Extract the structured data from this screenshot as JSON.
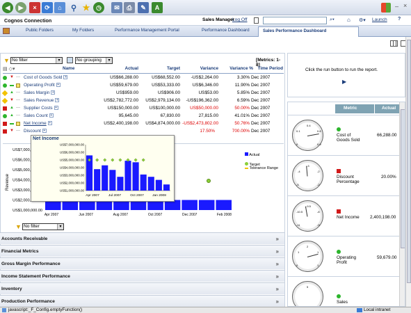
{
  "browser": {
    "back_label": "◀",
    "forward_label": "▶",
    "dropdown_arrow": "▾",
    "win_min": "–",
    "win_close": "×"
  },
  "portal": {
    "title": "Cognos Connection",
    "user": "Sales Manager",
    "logoff": "Log Off",
    "launch": "Launch",
    "home_glyph": "⌂",
    "help_glyph": "?"
  },
  "tabs": [
    {
      "label": "Public Folders"
    },
    {
      "label": "My Folders"
    },
    {
      "label": "Performance Management Portal"
    },
    {
      "label": "Performance Dashboard"
    },
    {
      "label": "Sales Performance Dashboard"
    }
  ],
  "filters": {
    "filter": "No filter",
    "grouping": "No grouping",
    "metrics_count": "[Metrics: 1-8]",
    "filter2": "No filter"
  },
  "table": {
    "headers": {
      "name": "Name",
      "actual": "Actual",
      "target": "Target",
      "variance": "Variance",
      "variance_pct": "Variance %",
      "time": "Time Period"
    },
    "rows": [
      {
        "name": "Cost of Goods Sold",
        "actual": "US$66,288.00",
        "target": "US$68,552.00",
        "variance": "-US$2,264.00",
        "variance_pct": "3.30%",
        "time": "Dec 2007"
      },
      {
        "name": "Operating Profit",
        "actual": "US$59,679.00",
        "target": "US$53,333.00",
        "variance": "US$6,346.00",
        "variance_pct": "11.90%",
        "time": "Dec 2007"
      },
      {
        "name": "Sales Margin",
        "actual": "US$959.00",
        "target": "US$906.00",
        "variance": "US$53.00",
        "variance_pct": "5.85%",
        "time": "Dec 2007"
      },
      {
        "name": "Sales Revenue",
        "actual": "US$2,782,772.00",
        "target": "US$2,979,134.00",
        "variance": "-US$196,362.00",
        "variance_pct": "6.59%",
        "time": "Dec 2007"
      },
      {
        "name": "Supplier Costs",
        "actual": "US$150,000.00",
        "target": "US$100,000.00",
        "variance": "US$50,000.00",
        "variance_pct": "50.00%",
        "time": "Dec 2007"
      },
      {
        "name": "Sales Count",
        "actual": "95,645.00",
        "target": "67,830.00",
        "variance": "27,815.00",
        "variance_pct": "41.01%",
        "time": "Dec 2007"
      },
      {
        "name": "Net Income",
        "actual": "US$2,400,198.00",
        "target": "US$4,874,000.00",
        "variance": "-US$2,473,802.00",
        "variance_pct": "50.76%",
        "time": "Dec 2007"
      },
      {
        "name": "Discount",
        "actual": "",
        "target": "",
        "variance": "",
        "variance_pct": "17.50%",
        "time": "Dec 2007",
        "extra": "700.00%"
      }
    ]
  },
  "status_colors": {
    "green": "#2db52d",
    "red": "#d11a1a",
    "yellow": "#f2c200",
    "accent": "#1b3d7a"
  },
  "chart_data": [
    {
      "type": "bar",
      "ylabel": "Revenue",
      "yticks": [
        "US$1,000,000.00",
        "US$2,000,000.00",
        "US$3,000,000.00",
        "US$4,000,000.00",
        "US$5,000,000.00",
        "US$6,000,000.00",
        "US$7,000,000.00"
      ],
      "xticks": [
        "Apr 2007",
        "Jun 2007",
        "Aug 2007",
        "Oct 2007",
        "Dec 2007",
        "Feb 2008"
      ],
      "legend": [
        "Actual",
        "Target",
        "Tolerance Range"
      ],
      "ylim": [
        1000000,
        7000000
      ],
      "values": [
        2000000,
        2000000,
        2000000,
        2000000,
        2000000,
        2000000,
        2000000,
        2000000,
        2000000,
        2000000,
        2000000
      ],
      "target_point": 3900000
    },
    {
      "type": "bar",
      "title": "Net Income",
      "yticks": [
        "US$1,000,000.00",
        "US$2,000,000.00",
        "US$3,000,000.00",
        "US$4,000,000.00",
        "US$5,000,000.00",
        "US$6,000,000.00",
        "US$7,000,000.00"
      ],
      "xticks": [
        "Apr 2007",
        "Jul 2007",
        "Oct 2007",
        "Jan 2008"
      ],
      "ylim": [
        1000000,
        7000000
      ],
      "values": [
        5600000,
        3800000,
        4300000,
        3700000,
        2800000,
        4900000,
        4700000,
        3100000,
        2800000,
        2400000,
        1800000
      ],
      "targets": [
        5000000,
        5000000,
        5000000,
        5000000,
        5000000,
        5000000,
        5000000,
        5000000
      ]
    }
  ],
  "accordion": [
    {
      "label": "Accounts Receivable"
    },
    {
      "label": "Financial Metrics"
    },
    {
      "label": "Gross Margin Performance"
    },
    {
      "label": "Income Statement Performance"
    },
    {
      "label": "Inventory"
    },
    {
      "label": "Production Performance"
    }
  ],
  "right_panel": {
    "run_hint": "Click the run button to run the report.",
    "run_glyph": "▶",
    "col_metric": "Metric",
    "col_actual": "Actual",
    "metrics": [
      {
        "name": "Cost of Goods Sold",
        "actual": "66,288.00",
        "status": "green",
        "scale_a": "0.1",
        "scale_b": "0.4",
        "scale_c": "0.8",
        "scale_d": "0",
        "scale_e": "0.9"
      },
      {
        "name": "Discount Percentage",
        "actual": "20.00%",
        "status": "red",
        "scale_a": "-4",
        "scale_b": "-3",
        "scale_c": "-2",
        "scale_d": "-5",
        "scale_e": "-2"
      },
      {
        "name": "Net Income",
        "actual": "2,400,198.00",
        "status": "red",
        "scale_a": "-10.5",
        "scale_b": "-9.5",
        "scale_c": "-8",
        "scale_d": "-11",
        "scale_e": "-9"
      },
      {
        "name": "Operating Profit",
        "actual": "59,679.00",
        "status": "green",
        "scale_a": "1",
        "scale_b": "2",
        "scale_c": "1",
        "scale_d": "0",
        "scale_e": "1"
      },
      {
        "name": "Sales",
        "actual": "",
        "status": "green",
        "scale_a": "",
        "scale_b": "5",
        "scale_c": "",
        "scale_d": "",
        "scale_e": ""
      }
    ]
  },
  "statusbar": {
    "url": "javascript:_F_Config.emptyFunction()",
    "zone": "Local intranet"
  }
}
